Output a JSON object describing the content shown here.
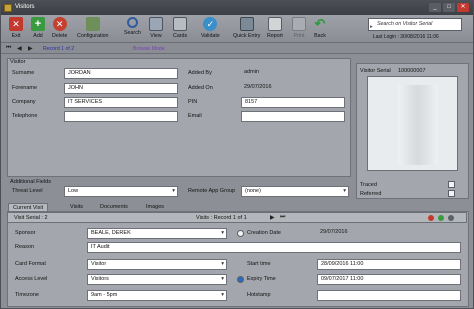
{
  "window": {
    "title": "Visitors"
  },
  "toolbar": {
    "exit": "Exit",
    "add": "Add",
    "delete": "Delete",
    "configuration": "Configuration",
    "search": "Search",
    "view": "View",
    "cards": "Cards",
    "validate": "Validate",
    "quick_entry": "Quick Entry",
    "report": "Report",
    "print": "Print",
    "back": "Back"
  },
  "search": {
    "placeholder": "Search on Visitor Serial"
  },
  "last_login": "Last Login : 30/08/2016 11:06",
  "nav": {
    "record": "Record 1 of 2",
    "mode": "Browse Mode"
  },
  "visitor": {
    "section": "Visitor",
    "surname_label": "Surname",
    "surname": "JORDAN",
    "forename_label": "Forename",
    "forename": "JOHN",
    "company_label": "Company",
    "company": "IT SERVICES",
    "telephone_label": "Telephone",
    "telephone": "",
    "added_by_label": "Added By",
    "added_by": "admin",
    "added_on_label": "Added On",
    "added_on": "29/07/2016",
    "pin_label": "PIN",
    "pin": "8157",
    "email_label": "Email",
    "email": "",
    "serial_label": "Visitor Serial",
    "serial": "100000007"
  },
  "additional": {
    "section": "Additional Fields",
    "threat_label": "Threat Level",
    "threat": "Low",
    "remote_label": "Remote App Group",
    "remote": "(none)",
    "traced_label": "Traced",
    "referred_label": "Referred"
  },
  "tabs": [
    "Current Visit",
    "Visits",
    "Documents",
    "Images"
  ],
  "visit": {
    "serial": "Visit Serial : 2",
    "record": "Visits : Record 1 of 1",
    "sponsor_label": "Sponsor",
    "sponsor": "BEALE, DEREK",
    "creation_label": "Creation Date",
    "creation": "29/07/2016",
    "reason_label": "Reason",
    "reason": "IT Audit",
    "card_format_label": "Card Format",
    "card_format": "Visitor",
    "access_label": "Access Level",
    "access": "Visitors",
    "timezone_label": "Timezone",
    "timezone": "9am - 5pm",
    "start_label": "Start time",
    "start": "28/09/2016 11:00",
    "expiry_label": "Expiry Time",
    "expiry": "09/07/2017 11:00",
    "hotstamp_label": "Hotstamp",
    "hotstamp": ""
  }
}
